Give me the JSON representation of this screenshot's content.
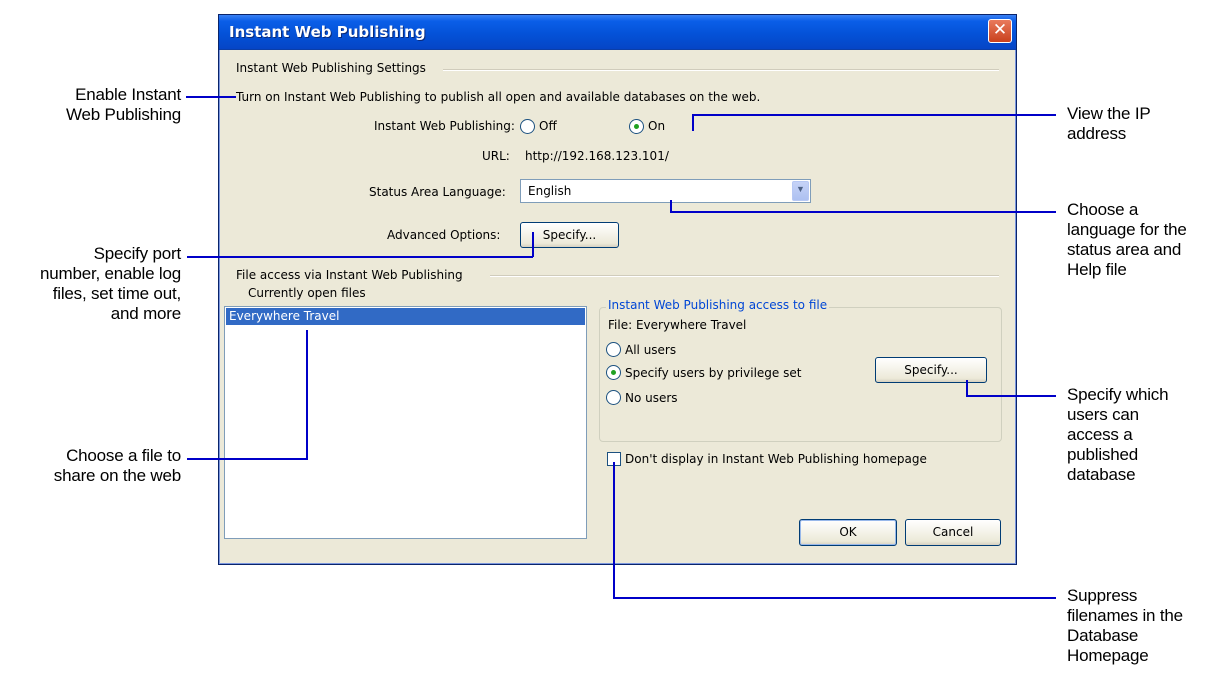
{
  "dialog": {
    "title": "Instant Web Publishing",
    "close_glyph": "✕",
    "settings_section": "Instant Web Publishing Settings",
    "intro_text": "Turn on Instant Web Publishing to publish all open and available databases on the web.",
    "iwp_label": "Instant Web Publishing:",
    "iwp_off_label": "Off",
    "iwp_on_label": "On",
    "iwp_selected": "On",
    "url_label": "URL:",
    "url_value": "http://192.168.123.101/",
    "language_label": "Status Area Language:",
    "language_value": "English",
    "advanced_label": "Advanced Options:",
    "specify_button": "Specify...",
    "file_access_section": "File access via Instant Web Publishing",
    "open_files_label": "Currently open files",
    "open_files": [
      "Everywhere Travel"
    ],
    "access_group_title": "Instant Web Publishing access to file",
    "file_label": "File: Everywhere Travel",
    "access_all_users": "All users",
    "access_privilege_set": "Specify users by privilege set",
    "access_no_users": "No users",
    "access_selected": "Specify users by privilege set",
    "access_specify_button": "Specify...",
    "dont_display_label": "Don't display in Instant Web Publishing homepage",
    "ok_button": "OK",
    "cancel_button": "Cancel"
  },
  "callouts": {
    "enable_iwp": [
      "Enable Instant",
      "Web Publishing"
    ],
    "specify_port": [
      "Specify port",
      "number, enable log",
      "files, set time out,",
      "and more"
    ],
    "choose_file": [
      "Choose a file to",
      "share on the web"
    ],
    "view_ip": [
      "View the IP",
      "address"
    ],
    "choose_language": [
      "Choose a",
      "language for the",
      "status area and",
      "Help file"
    ],
    "specify_users": [
      "Specify which",
      "users can",
      "access a",
      "published",
      "database"
    ],
    "suppress_filenames": [
      "Suppress",
      "filenames in the",
      "Database",
      "Homepage"
    ]
  },
  "colors": {
    "callout_line": "#0000c8",
    "title_bar": "#0452d8",
    "selection": "#316ac5",
    "dialog_bg": "#ece9d8"
  }
}
